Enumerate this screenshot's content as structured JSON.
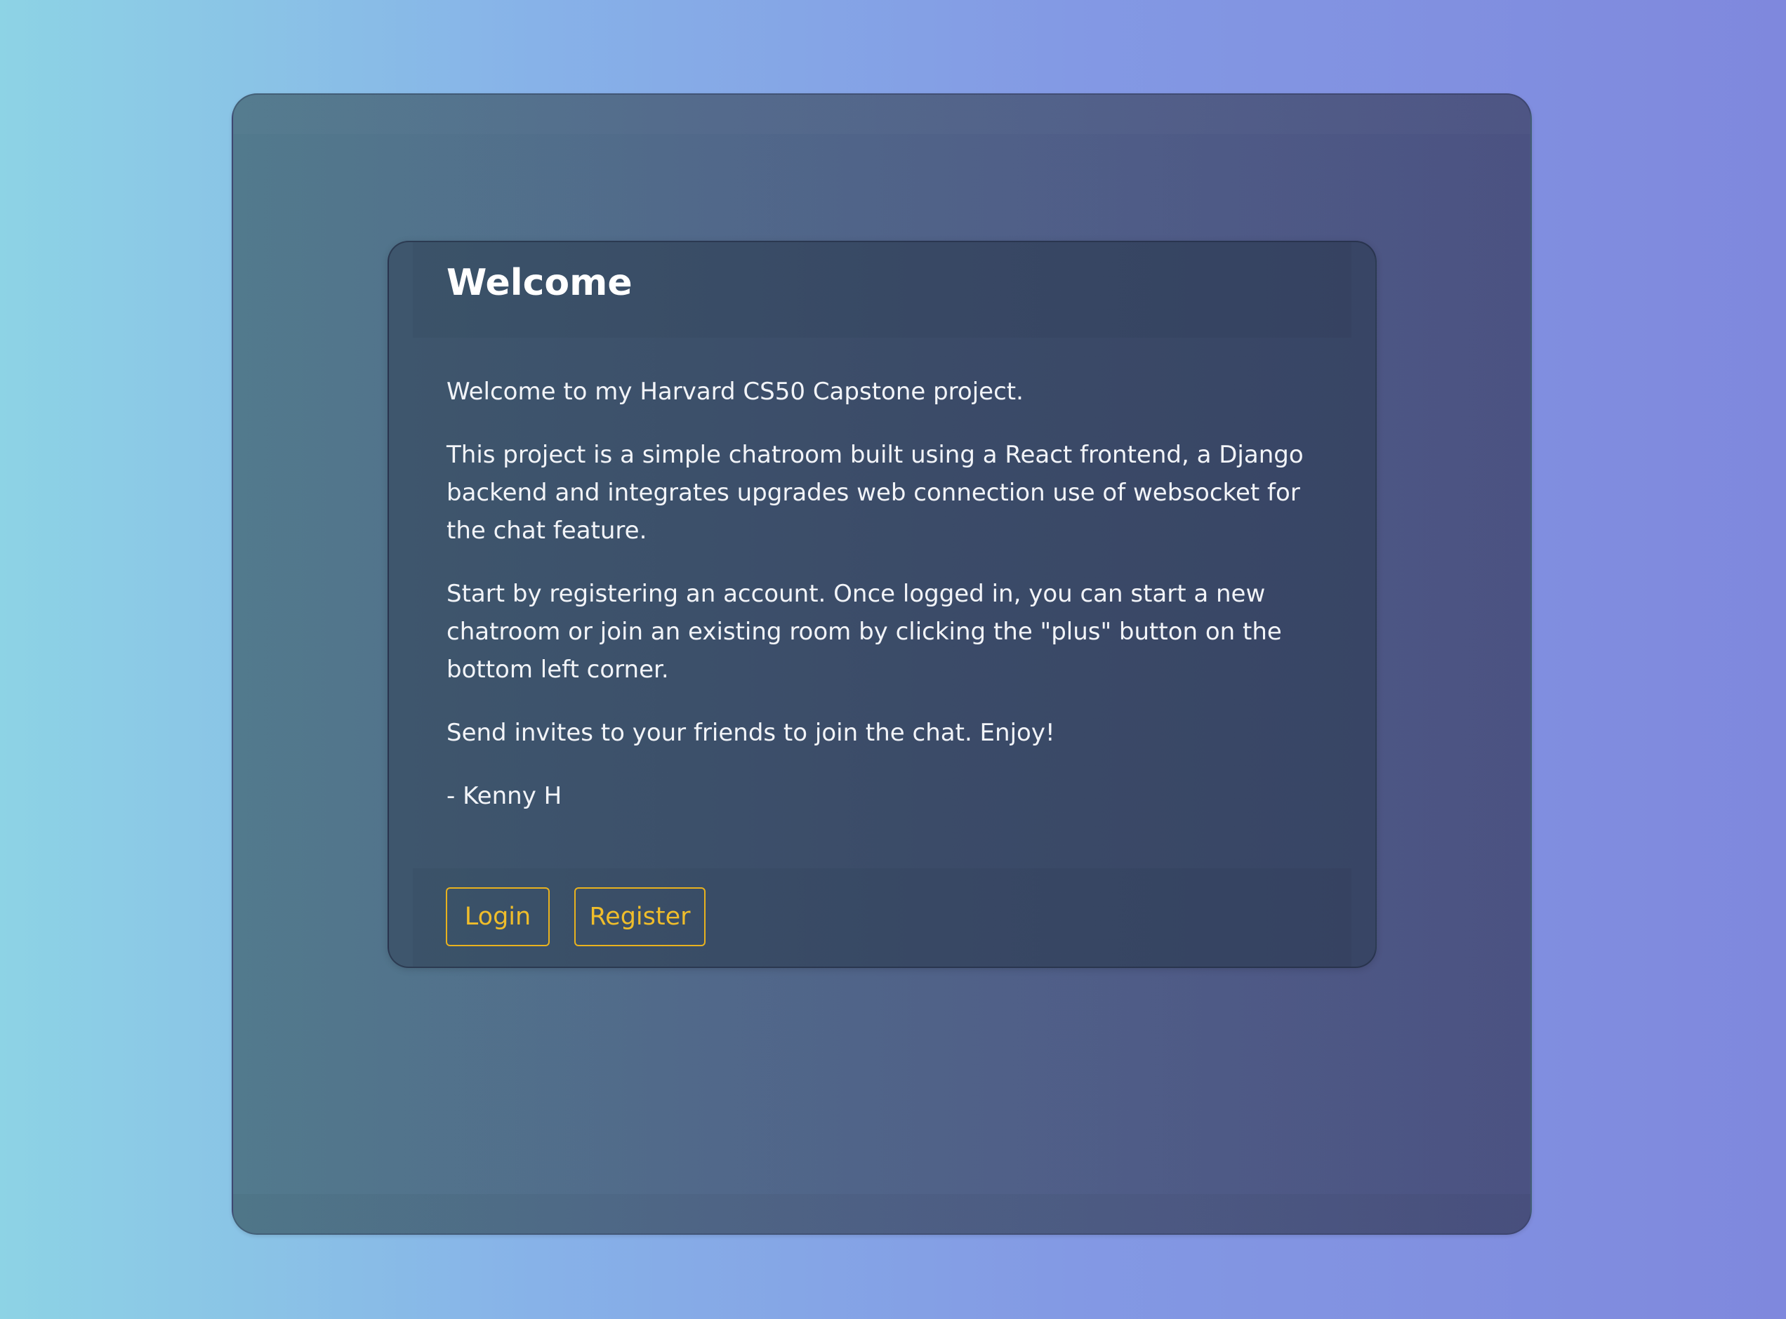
{
  "card": {
    "title": "Welcome",
    "paragraphs": [
      "Welcome to my Harvard CS50 Capstone project.",
      "This project is a simple chatroom built using a React frontend, a Django backend and integrates upgrades web connection use of websocket for the chat feature.",
      "Start by registering an account. Once logged in, you can start a new chatroom or join an existing room by clicking the \"plus\" button on the bottom left corner.",
      "Send invites to your friends to join the chat. Enjoy!",
      "- Kenny H"
    ]
  },
  "actions": {
    "login_label": "Login",
    "register_label": "Register"
  },
  "colors": {
    "accent": "#efbd2b",
    "background_left": "#8dd3e5",
    "background_right": "#7f88dd"
  }
}
